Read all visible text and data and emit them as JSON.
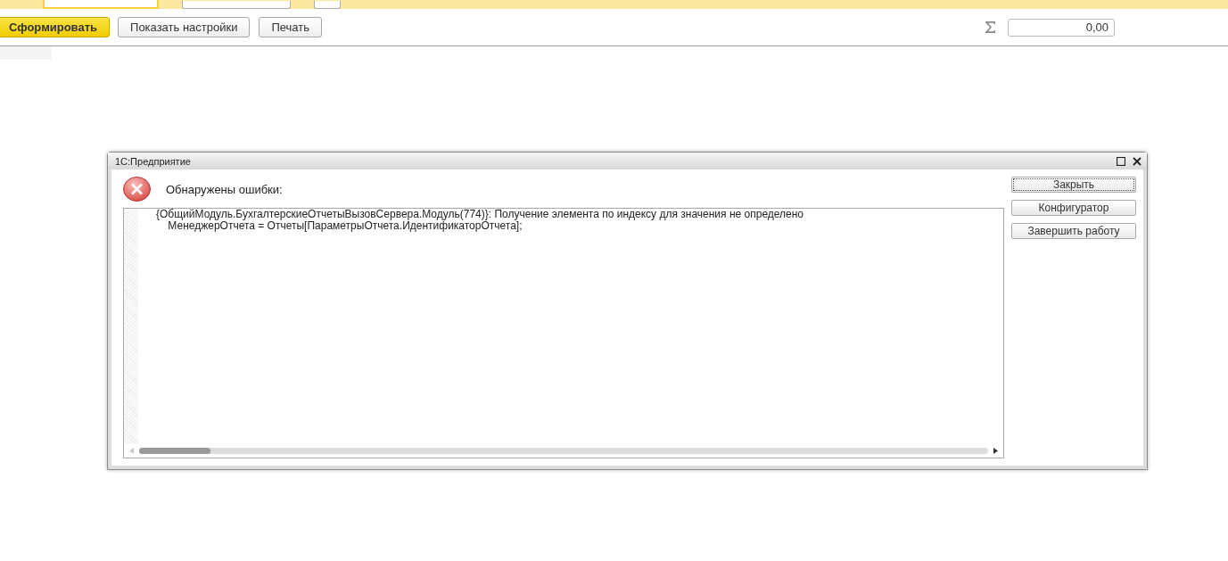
{
  "toolbar": {
    "buttons": [
      {
        "label": "Сформировать",
        "kind": "primary"
      },
      {
        "label": "Показать настройки",
        "kind": "normal"
      },
      {
        "label": "Печать",
        "kind": "normal"
      }
    ],
    "sum_field": {
      "value": "0,00"
    }
  },
  "dialog": {
    "title": "1С:Предприятие",
    "heading": "Обнаружены ошибки:",
    "message_lines": [
      "{ОбщийМодуль.БухгалтерскиеОтчетыВызовСервера.Модуль(774)}: Получение элемента по индексу для значения не определено",
      "    МенеджерОтчета = Отчеты[ПараметрыОтчета.ИдентификаторОтчета];"
    ],
    "buttons": [
      {
        "label": "Закрыть",
        "selected": true
      },
      {
        "label": "Конфигуратор",
        "selected": false
      },
      {
        "label": "Завершить работу",
        "selected": false
      }
    ]
  }
}
